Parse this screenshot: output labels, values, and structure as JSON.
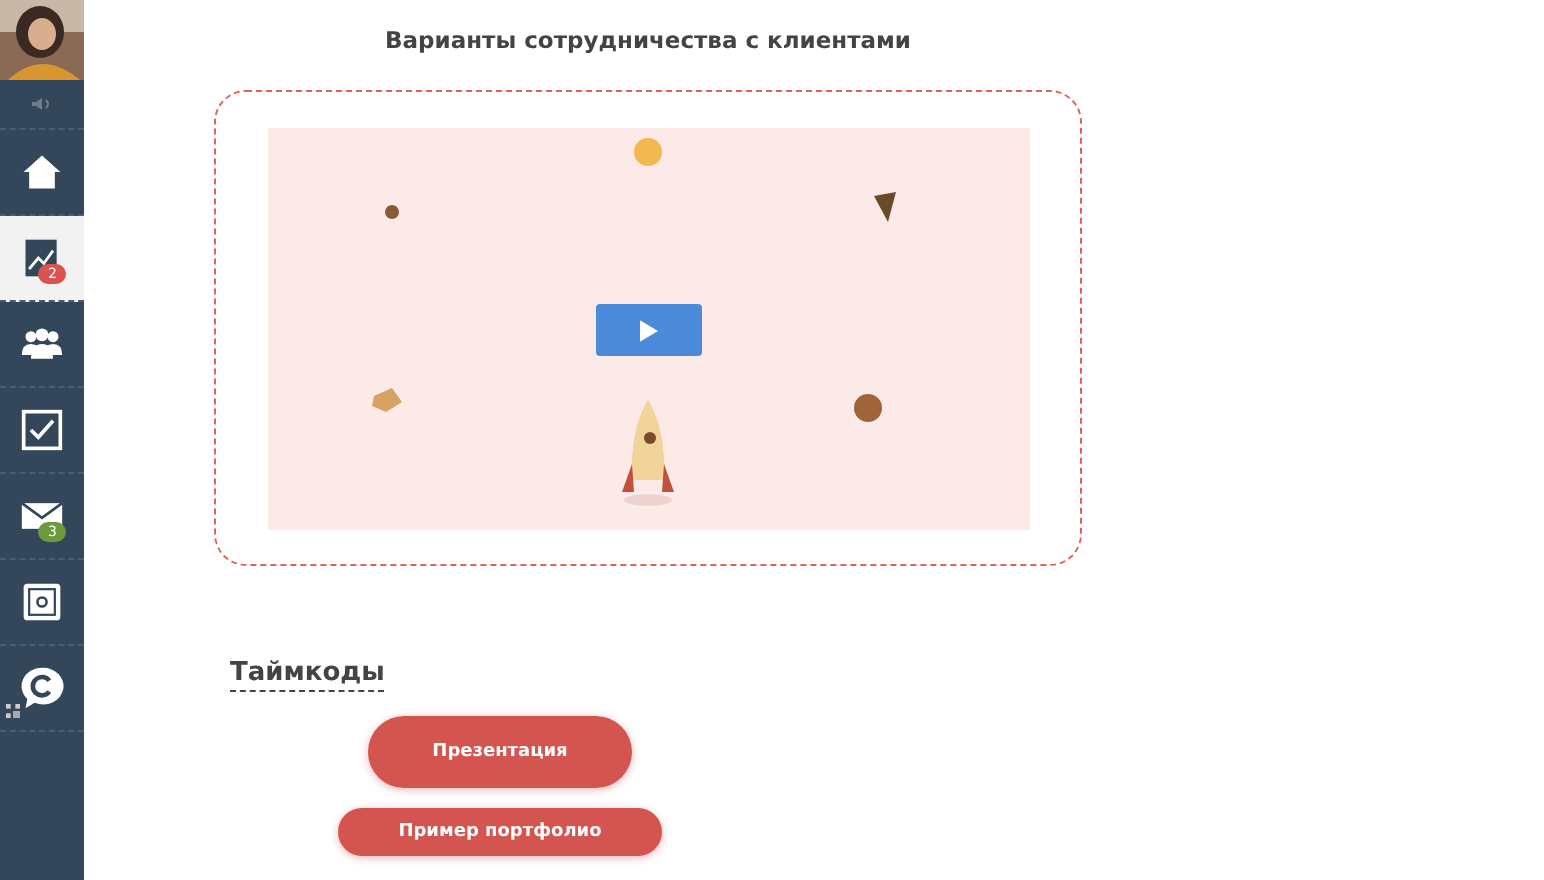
{
  "sidebar": {
    "items": [
      {
        "kind": "home",
        "selected": false
      },
      {
        "kind": "chart",
        "selected": true,
        "badge": "2",
        "color": "#d9534f"
      },
      {
        "kind": "people",
        "selected": false
      },
      {
        "kind": "tasks",
        "selected": false
      },
      {
        "kind": "mail",
        "selected": false,
        "badge": "3",
        "color": "#6b9a3a"
      },
      {
        "kind": "safe",
        "selected": false
      },
      {
        "kind": "chat",
        "selected": false
      }
    ]
  },
  "title": "Варианты сотрудничества с клиентами",
  "timecodes": {
    "heading": "Таймкоды",
    "buttons": [
      "Презентация",
      "Пример портфолио"
    ]
  }
}
